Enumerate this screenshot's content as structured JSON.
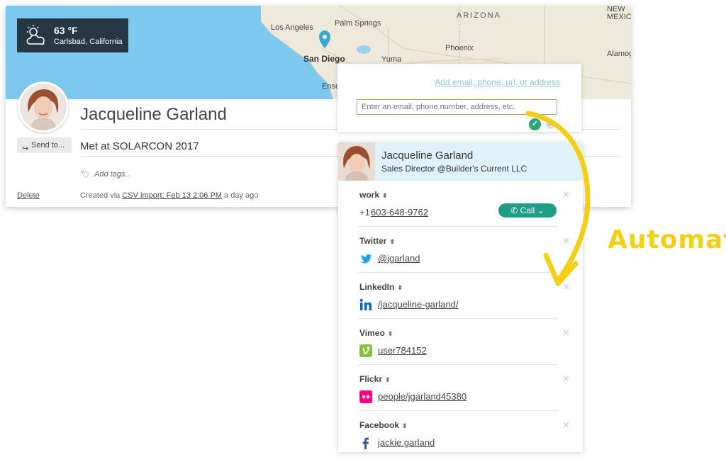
{
  "map": {
    "labels": {
      "los_angeles": "Los Angeles",
      "palm_springs": "Palm Springs",
      "san_diego": "San Diego",
      "yuma": "Yuma",
      "phoenix": "Phoenix",
      "arizona": "ARIZONA",
      "mexico": "NEW\nMEXIC",
      "alamogordo": "Alamog",
      "ensenada": "Ensen"
    }
  },
  "weather": {
    "temp": "63 °F",
    "location": "Carlsbad, California",
    "icon": "partly-cloudy-icon"
  },
  "contact": {
    "name": "Jacqueline Garland",
    "note": "Met at SOLARCON 2017",
    "send_to_label": "Send to...",
    "add_tags_label": "Add tags...",
    "delete_label": "Delete",
    "created_prefix": "Created via",
    "created_link": "CSV import: Feb 13 2:06 PM",
    "created_suffix": "a day ago"
  },
  "add_field": {
    "link_label": "Add email, phone, url, or address",
    "input_placeholder": "Enter an email, phone number, address, etc."
  },
  "enriched": {
    "name": "Jacqueline Garland",
    "title": "Sales Director @Builder's Current LLC",
    "fields": [
      {
        "label": "work",
        "prefix": "+1",
        "value": "603-648-9762",
        "action": "Call"
      },
      {
        "label": "Twitter",
        "value": "@jgarland",
        "icon": "twitter-icon",
        "color": "#1da1f2"
      },
      {
        "label": "LinkedIn",
        "value": "/jacqueline-garland/",
        "icon": "linkedin-icon",
        "color": "#0a66c2"
      },
      {
        "label": "Vimeo",
        "value": "user784152",
        "icon": "vimeo-icon",
        "color": "#86c03c"
      },
      {
        "label": "Flickr",
        "value": "people/jgarland45380",
        "icon": "flickr-icon",
        "color": "#ff0084"
      },
      {
        "label": "Facebook",
        "value": "jackie.garland",
        "icon": "facebook-icon",
        "color": "#3b5998"
      }
    ]
  },
  "annotation": {
    "text": "Automatic",
    "color": "#f4cf14"
  }
}
